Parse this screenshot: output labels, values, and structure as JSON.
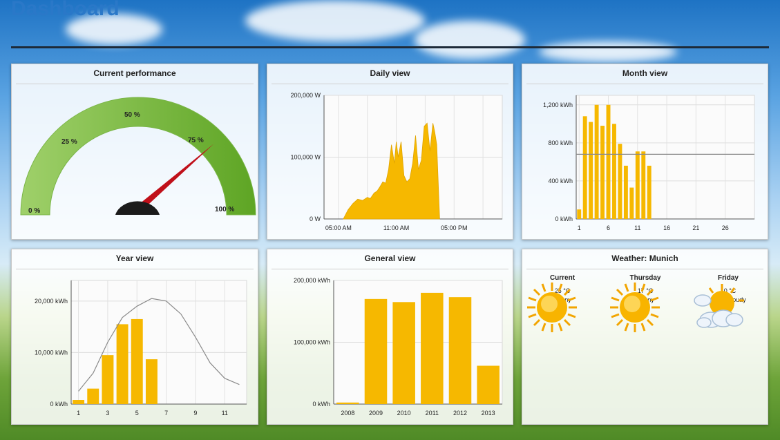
{
  "page": {
    "title": "Dashboard"
  },
  "panels": {
    "performance": {
      "title": "Current performance",
      "gauge": {
        "labels": [
          "0 %",
          "25 %",
          "50 %",
          "75 %",
          "100 %"
        ],
        "value_pct": 76,
        "colors": {
          "low": "#9fd06a",
          "high": "#5ea524",
          "needle": "#c0101a"
        }
      }
    },
    "daily": {
      "title": "Daily view"
    },
    "month": {
      "title": "Month view"
    },
    "year": {
      "title": "Year view"
    },
    "general": {
      "title": "General view"
    },
    "weather": {
      "title": "Weather: Munich",
      "days": [
        {
          "day": "Current",
          "temp": "25 °C",
          "cond": "Sunny",
          "icon": "sun-icon"
        },
        {
          "day": "Thursday",
          "temp": "17 °C",
          "cond": "Sunny",
          "icon": "sun-icon"
        },
        {
          "day": "Friday",
          "temp": "10 °C",
          "cond": "Partly cloudy",
          "icon": "partly-cloudy-icon"
        }
      ]
    }
  },
  "chart_data": [
    {
      "id": "daily",
      "type": "area",
      "yticks": [
        "200,000 W",
        "100,000 W",
        "0 W"
      ],
      "ylim": [
        0,
        200000
      ],
      "xticks": [
        "05:00 AM",
        "11:00 AM",
        "05:00 PM"
      ],
      "x_hours": [
        5.5,
        6.0,
        6.5,
        7.0,
        7.5,
        8.0,
        8.3,
        8.7,
        9.0,
        9.3,
        9.6,
        9.9,
        10.2,
        10.5,
        10.8,
        11.0,
        11.2,
        11.5,
        11.8,
        12.1,
        12.4,
        12.7,
        13.0,
        13.3,
        13.6,
        13.9,
        14.2,
        14.5,
        14.8,
        15.0,
        15.2,
        15.5
      ],
      "values": [
        0,
        15000,
        25000,
        32000,
        30000,
        35000,
        33000,
        42000,
        45000,
        52000,
        60000,
        58000,
        80000,
        120000,
        90000,
        125000,
        100000,
        125000,
        70000,
        60000,
        65000,
        90000,
        135000,
        80000,
        95000,
        150000,
        155000,
        110000,
        155000,
        140000,
        120000,
        0
      ],
      "x_range_hours": [
        3.5,
        22.0
      ],
      "color": "#f6b800"
    },
    {
      "id": "month",
      "type": "bar",
      "yticks": [
        "1,200 kWh",
        "800 kWh",
        "400 kWh",
        "0 kWh"
      ],
      "ylim": [
        0,
        1300
      ],
      "xticks": [
        "1",
        "6",
        "11",
        "16",
        "21",
        "26"
      ],
      "days": [
        1,
        2,
        3,
        4,
        5,
        6,
        7,
        8,
        9,
        10,
        11,
        12,
        13
      ],
      "values": [
        100,
        1080,
        1020,
        1200,
        980,
        1200,
        1000,
        790,
        560,
        330,
        710,
        710,
        560
      ],
      "average": 680,
      "x_range": [
        0.5,
        31
      ],
      "color": "#f6b800"
    },
    {
      "id": "year",
      "type": "bar",
      "yticks": [
        "20,000 kWh",
        "10,000 kWh",
        "0 kWh"
      ],
      "ylim": [
        0,
        24000
      ],
      "xticks": [
        "1",
        "3",
        "5",
        "7",
        "9",
        "11"
      ],
      "months": [
        1,
        2,
        3,
        4,
        5,
        6
      ],
      "values": [
        800,
        3000,
        9500,
        15500,
        16500,
        8700
      ],
      "curve": [
        2500,
        6000,
        12000,
        16800,
        19000,
        20500,
        20000,
        17500,
        13000,
        8000,
        5000,
        3800
      ],
      "x_range": [
        0.5,
        12.5
      ],
      "color": "#f6b800"
    },
    {
      "id": "general",
      "type": "bar",
      "yticks": [
        "200,000 kWh",
        "100,000 kWh",
        "0 kWh"
      ],
      "ylim": [
        0,
        200000
      ],
      "categories": [
        "2008",
        "2009",
        "2010",
        "2011",
        "2012",
        "2013"
      ],
      "values": [
        2500,
        170000,
        165000,
        180000,
        173000,
        62000
      ],
      "color": "#f6b800"
    }
  ]
}
